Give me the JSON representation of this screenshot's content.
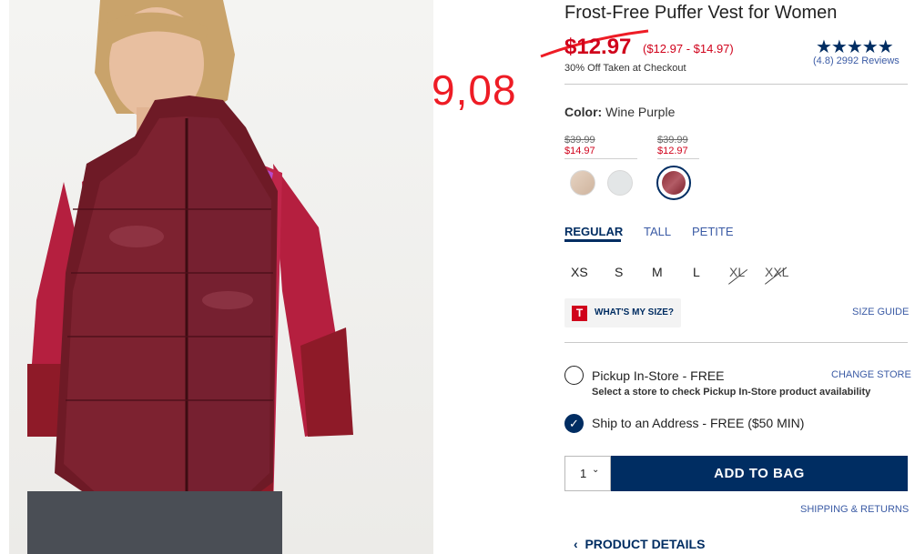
{
  "product": {
    "title": "Frost-Free Puffer Vest for Women",
    "price": "$12.97",
    "price_range": "($12.97 - $14.97)",
    "promo": "30% Off Taken at Checkout",
    "stars": "★★★★★",
    "reviews": "(4.8) 2992 Reviews",
    "rating": 4.8
  },
  "annotation": {
    "text": "9,08",
    "color": "#ee1c25"
  },
  "color": {
    "label": "Color:",
    "value": "Wine Purple",
    "groups": [
      {
        "was": "$39.99",
        "now": "$14.97"
      },
      {
        "was": "$39.99",
        "now": "$12.97"
      }
    ],
    "swatches": [
      "beige",
      "light-gray",
      "wine-purple"
    ],
    "selected": "wine-purple"
  },
  "fit_tabs": [
    "REGULAR",
    "TALL",
    "PETITE"
  ],
  "fit_selected": "REGULAR",
  "sizes": [
    "XS",
    "S",
    "M",
    "L",
    "XL",
    "XXL"
  ],
  "sizes_unavailable": [
    "XL",
    "XXL"
  ],
  "whats_my_size": {
    "badge": "T",
    "label": "WHAT'S MY SIZE?"
  },
  "size_guide": "SIZE GUIDE",
  "fulfillment": {
    "pickup": {
      "label": "Pickup In-Store - FREE",
      "sub": "Select a store to check Pickup In-Store product availability",
      "link": "CHANGE STORE",
      "checked": false
    },
    "ship": {
      "label": "Ship to an Address - FREE ($50 MIN)",
      "checked": true
    }
  },
  "quantity": {
    "value": "1",
    "chevron": "⌄"
  },
  "add_to_bag": "ADD TO BAG",
  "shipping_returns": "SHIPPING & RETURNS",
  "product_details": "PRODUCT DETAILS",
  "icons": {
    "check": "✓",
    "back_chevron": "‹"
  },
  "colors": {
    "navy": "#002d62",
    "sale_red": "#d0021b",
    "link_blue": "#3b5ba5"
  }
}
